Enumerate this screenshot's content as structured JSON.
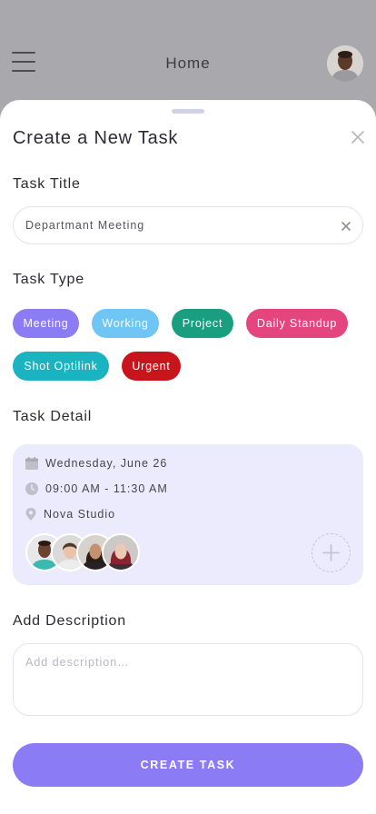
{
  "header": {
    "title": "Home",
    "menu_icon": "hamburger-menu-icon",
    "avatar_icon": "user-avatar"
  },
  "sheet": {
    "title": "Create a New Task",
    "close_icon": "close-icon"
  },
  "task_title": {
    "label": "Task Title",
    "value": "Departmant Meeting",
    "clear_icon": "clear-icon"
  },
  "task_type": {
    "label": "Task Type",
    "options": [
      {
        "label": "Meeting",
        "color": "#8b7cf6"
      },
      {
        "label": "Working",
        "color": "#6fc6f5"
      },
      {
        "label": "Project",
        "color": "#1a9e80"
      },
      {
        "label": "Daily Standup",
        "color": "#e5457d"
      },
      {
        "label": "Shot Optilink",
        "color": "#19b3c1"
      },
      {
        "label": "Urgent",
        "color": "#c8151b"
      }
    ]
  },
  "task_detail": {
    "label": "Task Detail",
    "date": "Wednesday, June 26",
    "time": "09:00 AM - 11:30 AM",
    "location": "Nova Studio",
    "date_icon": "calendar-icon",
    "time_icon": "clock-icon",
    "location_icon": "location-pin-icon",
    "add_person_icon": "plus-icon"
  },
  "description": {
    "label": "Add Description",
    "placeholder": "Add description…"
  },
  "create_button": {
    "label": "CREATE TASK",
    "color": "#8b7cf6"
  }
}
